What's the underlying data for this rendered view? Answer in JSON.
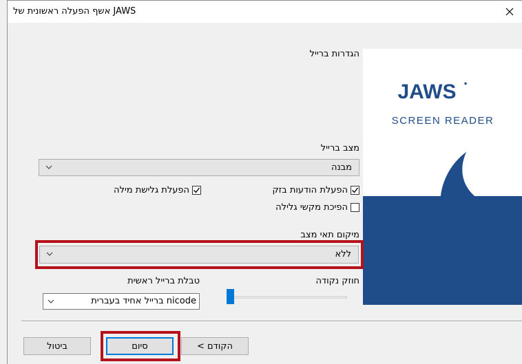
{
  "window": {
    "title": "אשף הפעלה ראשונית של JAWS"
  },
  "banner": {
    "logo_text": "JAWS",
    "logo_mark": "·",
    "subtitle": "SCREEN READER"
  },
  "braille_settings": {
    "section_title": "הגדרות ברייל",
    "mode": {
      "label": "מצב ברייל",
      "value": "מבנה"
    },
    "flash_messages": {
      "label": "הפעלת הודעות בזק",
      "checked": true
    },
    "word_wrap": {
      "label": "הפעלת גלישת מילה",
      "checked": true
    },
    "reverse_panning": {
      "label": "הפיכת מקשי גלילה",
      "checked": false
    },
    "status_cells": {
      "label": "מיקום תאי מצב",
      "value": "ללא"
    },
    "dot_strength": {
      "label": "חוזק נקודה",
      "level": 0
    },
    "primary_table": {
      "label": "טבלת ברייל ראשית",
      "value": "ברייל אחיד בעברית nicode"
    }
  },
  "buttons": {
    "back": "< הקודם",
    "finish": "סיום",
    "cancel": "ביטול"
  },
  "colors": {
    "accent": "#0078d7",
    "highlight": "#b5121b",
    "logo_blue": "#1f4d8a"
  }
}
